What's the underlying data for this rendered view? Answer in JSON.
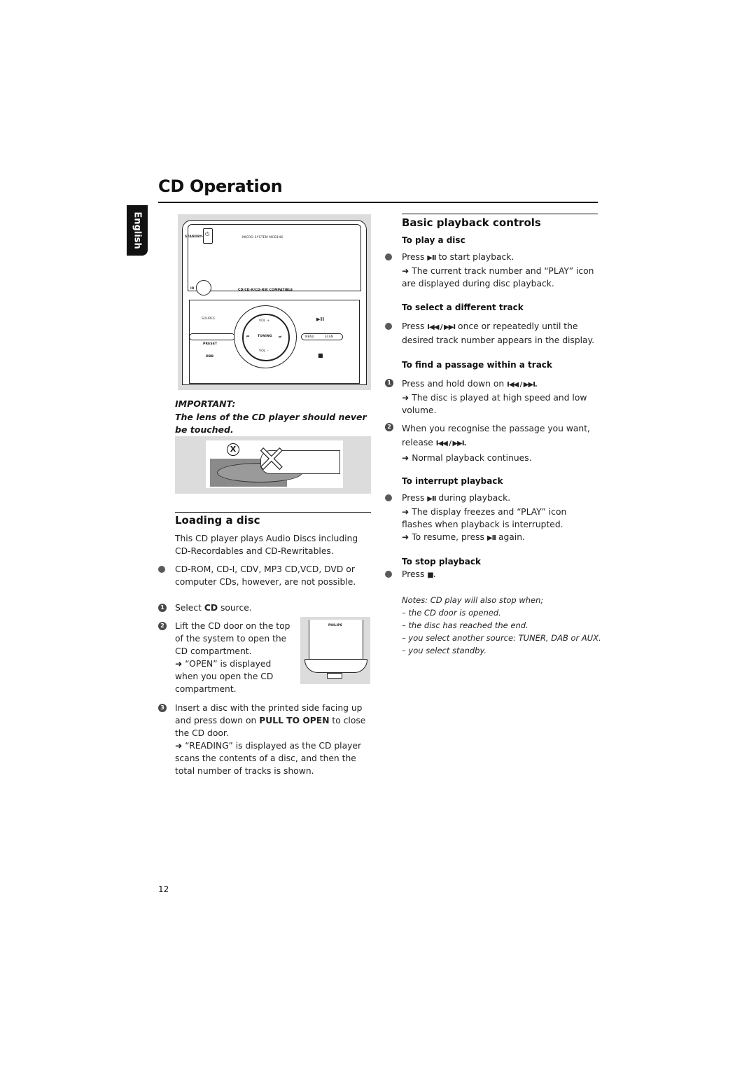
{
  "header": {
    "title": "CD Operation",
    "language_tab": "English"
  },
  "device_illustration": {
    "standby_label": "STANDBY·ON",
    "model_label": "MICRO SYSTEM MCB146",
    "ir_label": "IR",
    "compat_label": "CD/CD-R/CD-RW COMPATIBLE",
    "source_label": "SOURCE",
    "preset_label": "PRESET",
    "dbb_label": "DBB",
    "vol_up_label": "VOL +",
    "vol_down_label": "VOL –",
    "tuning_label": "TUNING",
    "prev_label": "⏮",
    "next_label": "⏭",
    "play_pause_label": "▶II",
    "menu_label": "MENU",
    "scan_label": "SCAN",
    "stop_label": "■"
  },
  "important": {
    "label": "IMPORTANT:",
    "text": "The lens of the CD player should never be touched.",
    "mark": "X"
  },
  "loading": {
    "heading": "Loading a disc",
    "intro": "This CD player plays Audio Discs including CD-Recordables and CD-Rewritables.",
    "bullet": "CD-ROM, CD-I, CDV, MP3 CD,VCD, DVD or computer CDs, however, are not possible.",
    "steps": [
      {
        "num": "1",
        "pre": "Select ",
        "bold": "CD",
        "post": " source."
      },
      {
        "num": "2",
        "lines": [
          "Lift the CD door on the top",
          "of the system to open the",
          "CD compartment.",
          "➜ “OPEN” is displayed",
          "when you open the CD",
          "compartment."
        ]
      },
      {
        "num": "3",
        "pre": "Insert a disc with the printed side facing up and press down on ",
        "bold": "PULL TO OPEN",
        "post": " to close the CD door.",
        "result": "➜ “READING” is displayed as the CD player scans the contents of a disc, and then the total number of tracks is shown."
      }
    ],
    "door_brand": "PHILIPS"
  },
  "playback": {
    "heading": "Basic playback controls",
    "play": {
      "title": "To play a disc",
      "press": "Press",
      "icon": "▶II",
      "action": "to start playback.",
      "result": "➜ The current track number and “PLAY” icon are displayed during disc playback."
    },
    "select": {
      "title": "To select a different track",
      "press": "Press",
      "icon": "I◀◀ / ▶▶I",
      "action": "once or repeatedly until the desired track number appears in the display."
    },
    "find": {
      "title": "To find a passage within a track",
      "step1_text": "Press and hold down on",
      "step1_icon": "I◀◀ / ▶▶I.",
      "step1_result": "➜ The disc is played at high speed and low volume.",
      "step2_text": "When you recognise the passage you want,",
      "step2_release": "release",
      "step2_icon": "I◀◀ / ▶▶I.",
      "step2_result": "➜ Normal playback continues."
    },
    "interrupt": {
      "title": "To interrupt playback",
      "press": "Press",
      "icon": "▶II",
      "action": "during playback.",
      "result1": "➜ The display freezes and “PLAY” icon flashes when playback is interrupted.",
      "result2_pre": "➜ To resume, press",
      "result2_icon": "▶II",
      "result2_post": "again."
    },
    "stop": {
      "title": "To stop playback",
      "press": "Press",
      "icon": "■",
      "post": "."
    },
    "notes": [
      "Notes: CD play will also stop when;",
      "– the CD door is opened.",
      "– the disc has reached the end.",
      "– you select another source: TUNER, DAB or AUX.",
      "– you select standby."
    ]
  },
  "footer": {
    "page_number": "12"
  }
}
